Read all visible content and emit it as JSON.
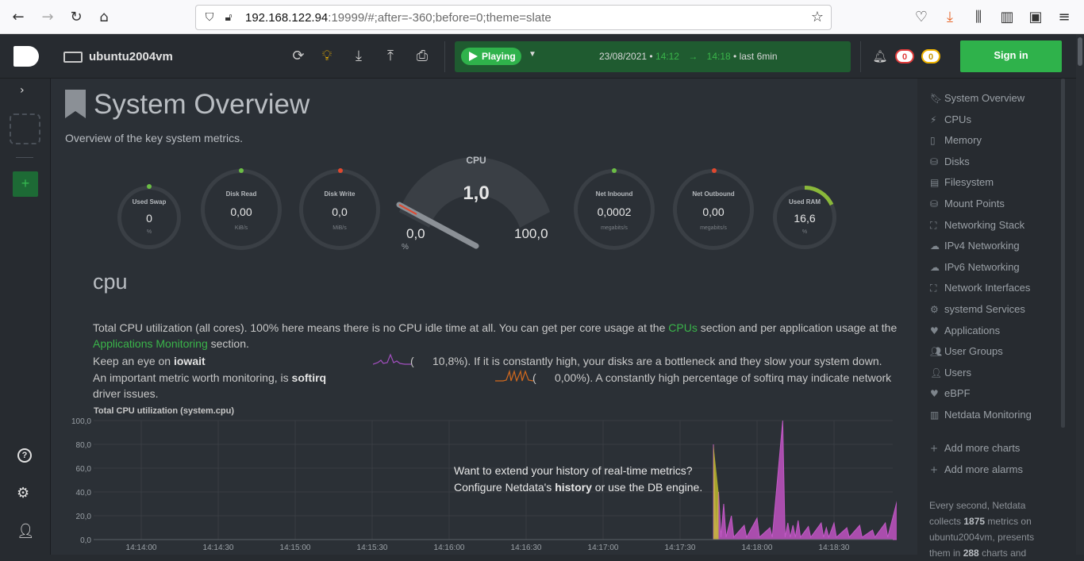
{
  "browser": {
    "url_host": "192.168.122.94",
    "url_rest": ":19999/#;after=-360;before=0;theme=slate"
  },
  "header": {
    "hostname": "ubuntu2004vm",
    "play_label": "Playing",
    "date": "23/08/2021",
    "time_from": "14:12",
    "time_to": "14:18",
    "range_label": "last  6min",
    "alarms_critical": "0",
    "alarms_warning": "0",
    "sign_in": "Sign in"
  },
  "page": {
    "title": "System Overview",
    "subtitle": "Overview of the key system metrics."
  },
  "gauges": {
    "swap": {
      "title": "Used Swap",
      "value": "0",
      "unit": "%"
    },
    "disk_read": {
      "title": "Disk Read",
      "value": "0,00",
      "unit": "KiB/s"
    },
    "disk_write": {
      "title": "Disk Write",
      "value": "0,0",
      "unit": "MiB/s"
    },
    "cpu": {
      "title": "CPU",
      "value": "1,0",
      "min": "0,0",
      "max": "100,0",
      "unit": "%"
    },
    "net_in": {
      "title": "Net Inbound",
      "value": "0,0002",
      "unit": "megabits/s"
    },
    "net_out": {
      "title": "Net Outbound",
      "value": "0,00",
      "unit": "megabits/s"
    },
    "ram": {
      "title": "Used RAM",
      "value": "16,6",
      "unit": "%"
    }
  },
  "section": {
    "heading": "cpu",
    "desc_1": "Total CPU utilization (all cores). 100% here means there is no CPU idle time at all. You can get per core usage at the",
    "link_cpus": "CPUs",
    "desc_2": "section and per application usage at the",
    "link_apps": "Applications Monitoring",
    "desc_3": "section.",
    "iowait_pre": "Keep an eye on",
    "iowait_key": "iowait",
    "iowait_val": "10,8%",
    "iowait_post": "). If it is constantly high, your disks are a bottleneck and they slow your system down.",
    "softirq_pre": "An important metric worth monitoring, is",
    "softirq_key": "softirq",
    "softirq_val": "0,00%",
    "softirq_post": "). A constantly high percentage of softirq may indicate network",
    "softirq_end": "driver issues."
  },
  "chart_data": {
    "type": "area",
    "title": "Total CPU utilization (system.cpu)",
    "ylim": [
      0,
      100
    ],
    "y_ticks": [
      "100,0",
      "80,0",
      "60,0",
      "40,0",
      "20,0",
      "0,0"
    ],
    "x_ticks": [
      "14:14:00",
      "14:14:30",
      "14:15:00",
      "14:15:30",
      "14:16:00",
      "14:16:30",
      "14:17:00",
      "14:17:30",
      "14:18:00",
      "14:18:30"
    ],
    "x": [
      "14:17:43",
      "14:17:45",
      "14:17:47",
      "14:17:50",
      "14:17:55",
      "14:18:00",
      "14:18:05",
      "14:18:10",
      "14:18:12",
      "14:18:14",
      "14:18:16",
      "14:18:20",
      "14:18:25",
      "14:18:27",
      "14:18:30",
      "14:18:35",
      "14:18:40",
      "14:18:45",
      "14:18:50",
      "14:18:55"
    ],
    "series": [
      {
        "values": [
          80,
          40,
          30,
          20,
          12,
          18,
          10,
          100,
          14,
          12,
          16,
          11,
          14,
          10,
          14,
          10,
          12,
          8,
          14,
          36
        ]
      }
    ],
    "overlay_line_1": "Want to extend your history of real-time metrics?",
    "overlay_line_2_pre": "Configure Netdata's",
    "overlay_line_2_key": "history",
    "overlay_line_2_mid": "or use the",
    "overlay_line_2_link": "DB engine",
    "overlay_line_2_end": "."
  },
  "nav": {
    "items": [
      "System Overview",
      "CPUs",
      "Memory",
      "Disks",
      "Filesystem",
      "Mount Points",
      "Networking Stack",
      "IPv4 Networking",
      "IPv6 Networking",
      "Network Interfaces",
      "systemd Services",
      "Applications",
      "User Groups",
      "Users",
      "eBPF",
      "Netdata Monitoring"
    ],
    "add_charts": "Add more charts",
    "add_alarms": "Add more alarms",
    "footer_1": "Every second, Netdata",
    "footer_2_pre": "collects",
    "footer_2_num": "1875",
    "footer_2_post": "metrics on",
    "footer_3": "ubuntu2004vm, presents",
    "footer_4_pre": "them in",
    "footer_4_num": "288",
    "footer_4_post": "charts and"
  }
}
